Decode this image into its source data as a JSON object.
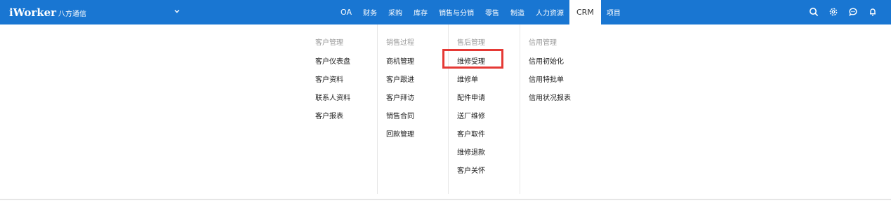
{
  "header": {
    "logo": "iWorker",
    "company": "八方通信",
    "nav": [
      {
        "label": "OA"
      },
      {
        "label": "财务"
      },
      {
        "label": "采购"
      },
      {
        "label": "库存"
      },
      {
        "label": "销售与分销"
      },
      {
        "label": "零售"
      },
      {
        "label": "制造"
      },
      {
        "label": "人力资源"
      },
      {
        "label": "CRM"
      },
      {
        "label": "项目"
      }
    ],
    "active_nav": "CRM",
    "icons": [
      "search-icon",
      "settings-icon",
      "chat-icon",
      "bell-icon"
    ],
    "brand_color": "#1976d2"
  },
  "menu": {
    "columns": [
      {
        "title": "客户管理",
        "items": [
          "客户仪表盘",
          "客户资料",
          "联系人资料",
          "客户报表"
        ]
      },
      {
        "title": "销售过程",
        "items": [
          "商机管理",
          "客户跟进",
          "客户拜访",
          "销售合同",
          "回款管理"
        ]
      },
      {
        "title": "售后管理",
        "items": [
          "维修受理",
          "维修单",
          "配件申请",
          "送厂维修",
          "客户取件",
          "维修退款",
          "客户关怀"
        ]
      },
      {
        "title": "信用管理",
        "items": [
          "信用初始化",
          "信用特批单",
          "信用状况报表"
        ]
      }
    ],
    "highlighted_item": "维修受理",
    "highlight_color": "#e53935"
  }
}
